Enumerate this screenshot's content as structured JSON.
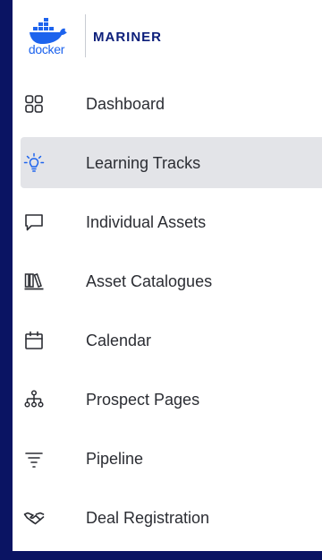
{
  "brand": {
    "logo_word": "docker",
    "product_name": "MARINER",
    "logo_color": "#1d63ed",
    "name_color": "#0b1e7a"
  },
  "sidebar": {
    "active_index": 1,
    "items": [
      {
        "label": "Dashboard",
        "icon": "grid-icon"
      },
      {
        "label": "Learning Tracks",
        "icon": "lightbulb-icon"
      },
      {
        "label": "Individual Assets",
        "icon": "chat-bubble-icon"
      },
      {
        "label": "Asset Catalogues",
        "icon": "library-books-icon"
      },
      {
        "label": "Calendar",
        "icon": "calendar-icon"
      },
      {
        "label": "Prospect Pages",
        "icon": "sitemap-icon"
      },
      {
        "label": "Pipeline",
        "icon": "filter-lines-icon"
      },
      {
        "label": "Deal Registration",
        "icon": "handshake-icon"
      }
    ]
  },
  "colors": {
    "frame_background": "#0a1463",
    "active_item_background": "#e3e4e8",
    "active_icon": "#1d63ed",
    "text": "#2b2d33"
  }
}
